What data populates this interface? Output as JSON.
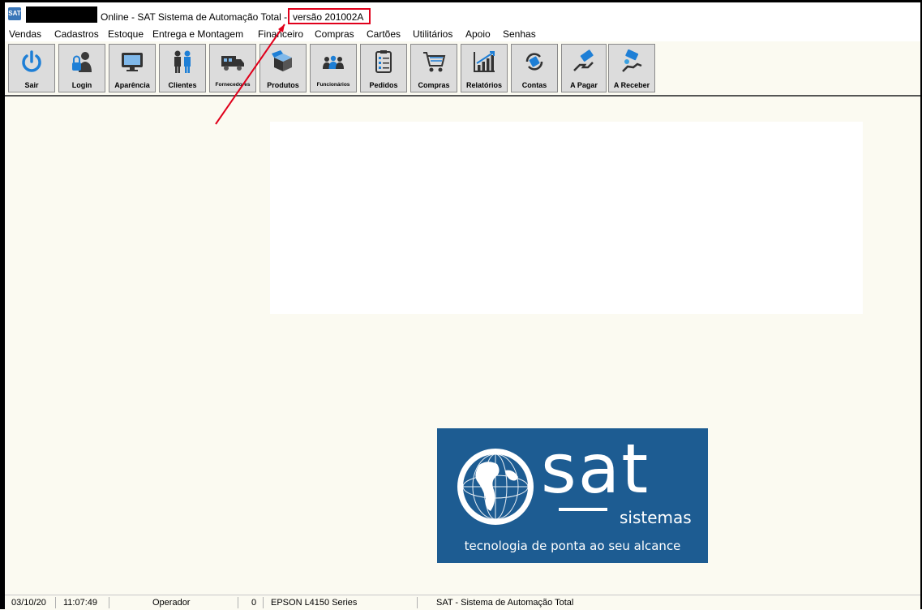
{
  "window": {
    "title": "Online - SAT Sistema de Automação Total -",
    "version": "versão 201002A"
  },
  "menu": [
    "Vendas",
    "Cadastros",
    "Estoque",
    "Entrega e Montagem",
    "Financeiro",
    "Compras",
    "Cartões",
    "Utilitários",
    "Apoio",
    "Senhas"
  ],
  "toolbar": {
    "sair": "Sair",
    "login": "Login",
    "aparencia": "Aparência",
    "clientes": "Clientes",
    "fornecedores": "Fornecedores",
    "produtos": "Produtos",
    "funcionarios": "Funcionários",
    "pedidos": "Pedidos",
    "compras": "Compras",
    "relatorios": "Relatórios",
    "contas": "Contas",
    "a_pagar": "A Pagar",
    "a_receber": "A Receber"
  },
  "logo": {
    "brand": "sat",
    "sub": "sistemas",
    "tagline": "tecnologia de ponta ao seu alcance"
  },
  "status": {
    "date": "03/10/20",
    "time": "11:07:49",
    "user": "Operador",
    "count": "0",
    "printer": "EPSON L4150 Series",
    "system": "SAT - Sistema de Automação Total"
  },
  "colors": {
    "annotation": "#e0001b",
    "logo_bg": "#1d5c92",
    "background": "#fbfaf1"
  }
}
